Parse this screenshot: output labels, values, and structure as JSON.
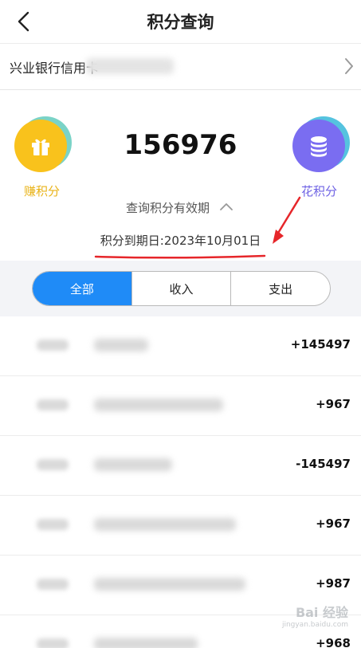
{
  "header": {
    "title": "积分查询",
    "back_icon": "back-arrow-icon"
  },
  "card": {
    "label": "兴业银行信用卡",
    "arrow_icon": "chevron-right-icon"
  },
  "points": {
    "earn_label": "赚积分",
    "earn_icon": "gift-icon",
    "total": "156976",
    "spend_label": "花积分",
    "spend_icon": "coin-stack-icon",
    "validity_label": "查询积分有效期",
    "validity_icon": "chevron-up-icon",
    "expire_text": "积分到期日:2023年10月01日"
  },
  "tabs": [
    {
      "label": "全部",
      "active": true
    },
    {
      "label": "收入",
      "active": false
    },
    {
      "label": "支出",
      "active": false
    }
  ],
  "transactions": [
    {
      "amount": "+145497"
    },
    {
      "amount": "+967"
    },
    {
      "amount": "-145497"
    },
    {
      "amount": "+967"
    },
    {
      "amount": "+987"
    },
    {
      "amount": "+968"
    }
  ],
  "watermark": {
    "main": "Bai 经验",
    "sub": "jingyan.baidu.com"
  },
  "colors": {
    "accent": "#1f8bf7",
    "earn": "#f9c21c",
    "spend": "#7a6df1",
    "annotation": "#e6262a"
  }
}
